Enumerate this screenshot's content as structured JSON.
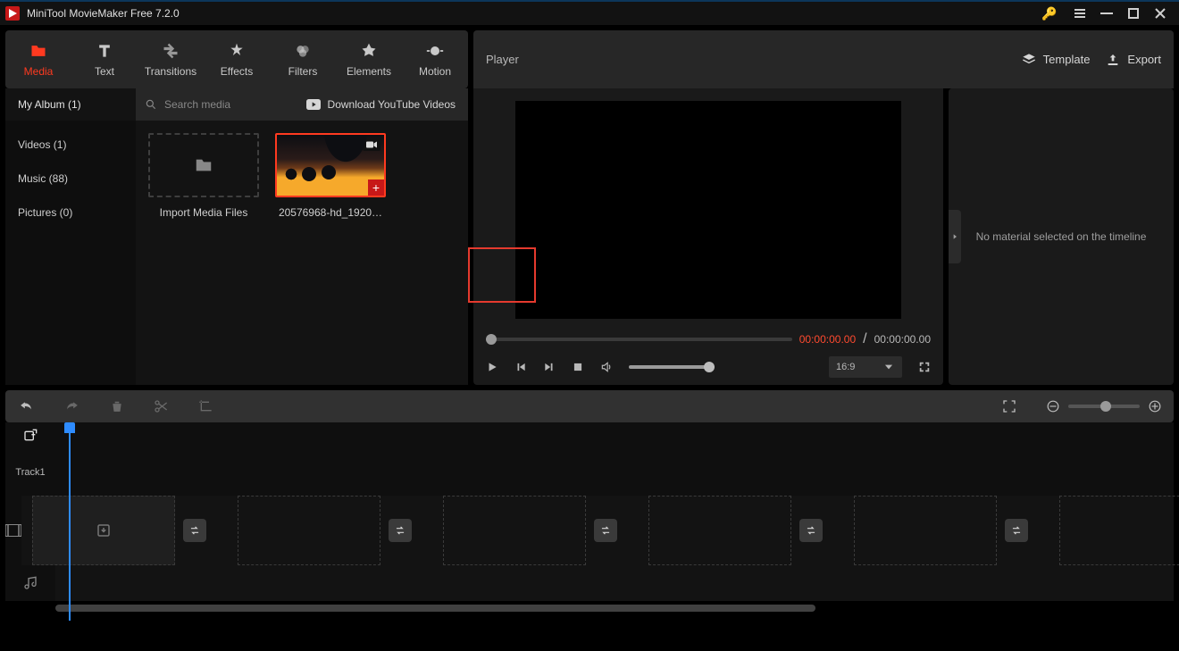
{
  "app_title": "MiniTool MovieMaker Free 7.2.0",
  "ribbon": {
    "tabs": [
      {
        "label": "Media",
        "icon": "folder-icon",
        "active": true
      },
      {
        "label": "Text",
        "icon": "text-icon"
      },
      {
        "label": "Transitions",
        "icon": "transitions-icon"
      },
      {
        "label": "Effects",
        "icon": "effects-icon"
      },
      {
        "label": "Filters",
        "icon": "filters-icon"
      },
      {
        "label": "Elements",
        "icon": "elements-icon"
      },
      {
        "label": "Motion",
        "icon": "motion-icon"
      }
    ]
  },
  "player": {
    "title": "Player",
    "template_label": "Template",
    "export_label": "Export",
    "current_time": "00:00:00.00",
    "separator": " / ",
    "duration": "00:00:00.00",
    "aspect": "16:9"
  },
  "library": {
    "album_label": "My Album (1)",
    "search_placeholder": "Search media",
    "download_label": "Download YouTube Videos",
    "sidebar": [
      {
        "label": "Videos (1)"
      },
      {
        "label": "Music (88)"
      },
      {
        "label": "Pictures (0)"
      }
    ],
    "import_label": "Import Media Files",
    "clip_name": "20576968-hd_1920…"
  },
  "timeline": {
    "track_label": "Track1"
  },
  "sidepanel": {
    "empty_text": "No material selected on the timeline"
  }
}
